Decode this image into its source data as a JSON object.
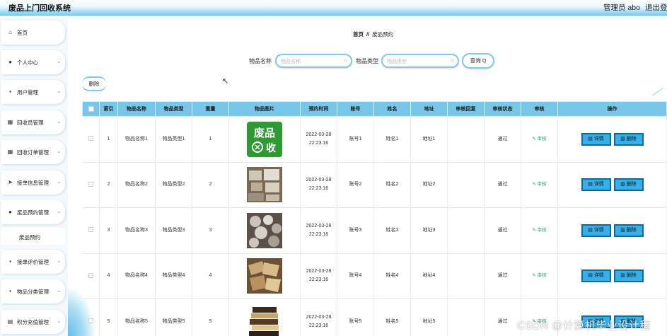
{
  "header": {
    "title": "废品上门回收系统",
    "admin": "管理员 abo",
    "logout": "退出登录"
  },
  "sidebar": {
    "items": [
      {
        "label": "首页",
        "icon": "home-icon"
      },
      {
        "label": "个人中心",
        "icon": "user-icon"
      },
      {
        "label": "用户管理",
        "icon": "grid-icon"
      },
      {
        "label": "回收员管理",
        "icon": "table-icon"
      },
      {
        "label": "回收订单管理",
        "icon": "table-icon"
      },
      {
        "label": "接单信息管理",
        "icon": "send-icon"
      },
      {
        "label": "废品预约管理",
        "icon": "user-icon"
      },
      {
        "label": "废品预约",
        "icon": ""
      },
      {
        "label": "接单评价管理",
        "icon": "grid-icon"
      },
      {
        "label": "物品分类管理",
        "icon": "grid-icon"
      },
      {
        "label": "积分充值管理",
        "icon": "doc-icon"
      }
    ]
  },
  "breadcrumb": {
    "home": "首页",
    "sep": "//",
    "current": "废品预约"
  },
  "search": {
    "name_label": "物品名称",
    "name_placeholder": "物品名称",
    "type_label": "物品类型",
    "type_placeholder": "物品类型",
    "query_label": "查询"
  },
  "toolbar": {
    "delete_label": "删除"
  },
  "table": {
    "headers": [
      "",
      "索引",
      "物品名称",
      "物品类型",
      "重量",
      "物品图片",
      "预约时间",
      "账号",
      "姓名",
      "地址",
      "审核回复",
      "审核状态",
      "审核",
      "操作"
    ],
    "rows": [
      {
        "index": "1",
        "name": "物品名称1",
        "type": "物品类型1",
        "weight": "1",
        "date": "2022-03-28",
        "time": "22:23:16",
        "account": "账号1",
        "person": "姓名1",
        "address": "地址1",
        "reply": "",
        "status": "通过",
        "audit": "审核",
        "image": "waste-logo"
      },
      {
        "index": "2",
        "name": "物品名称2",
        "type": "物品类型2",
        "weight": "2",
        "date": "2022-03-28",
        "time": "22:23:16",
        "account": "账号2",
        "person": "姓名2",
        "address": "地址2",
        "reply": "",
        "status": "通过",
        "audit": "审核",
        "image": "electronics-photo"
      },
      {
        "index": "3",
        "name": "物品名称3",
        "type": "物品类型3",
        "weight": "3",
        "date": "2022-03-28",
        "time": "22:23:16",
        "account": "账号3",
        "person": "姓名3",
        "address": "地址3",
        "reply": "",
        "status": "通过",
        "audit": "审核",
        "image": "cans-photo"
      },
      {
        "index": "4",
        "name": "物品名称4",
        "type": "物品类型4",
        "weight": "4",
        "date": "2022-03-28",
        "time": "22:23:16",
        "account": "账号4",
        "person": "姓名4",
        "address": "地址4",
        "reply": "",
        "status": "通过",
        "audit": "审核",
        "image": "cardboard-photo"
      },
      {
        "index": "5",
        "name": "物品名称5",
        "type": "物品类型5",
        "weight": "5",
        "date": "2022-03-28",
        "time": "22:23:16",
        "account": "账号5",
        "person": "姓名5",
        "address": "地址5",
        "reply": "",
        "status": "通过",
        "audit": "审核",
        "image": "books-photo"
      }
    ],
    "detail_label": "详情",
    "delete_label": "删除"
  },
  "watermark": "CSDN @计算机毕业设计程",
  "logo_text": {
    "line1": "废品",
    "line2": "收"
  }
}
